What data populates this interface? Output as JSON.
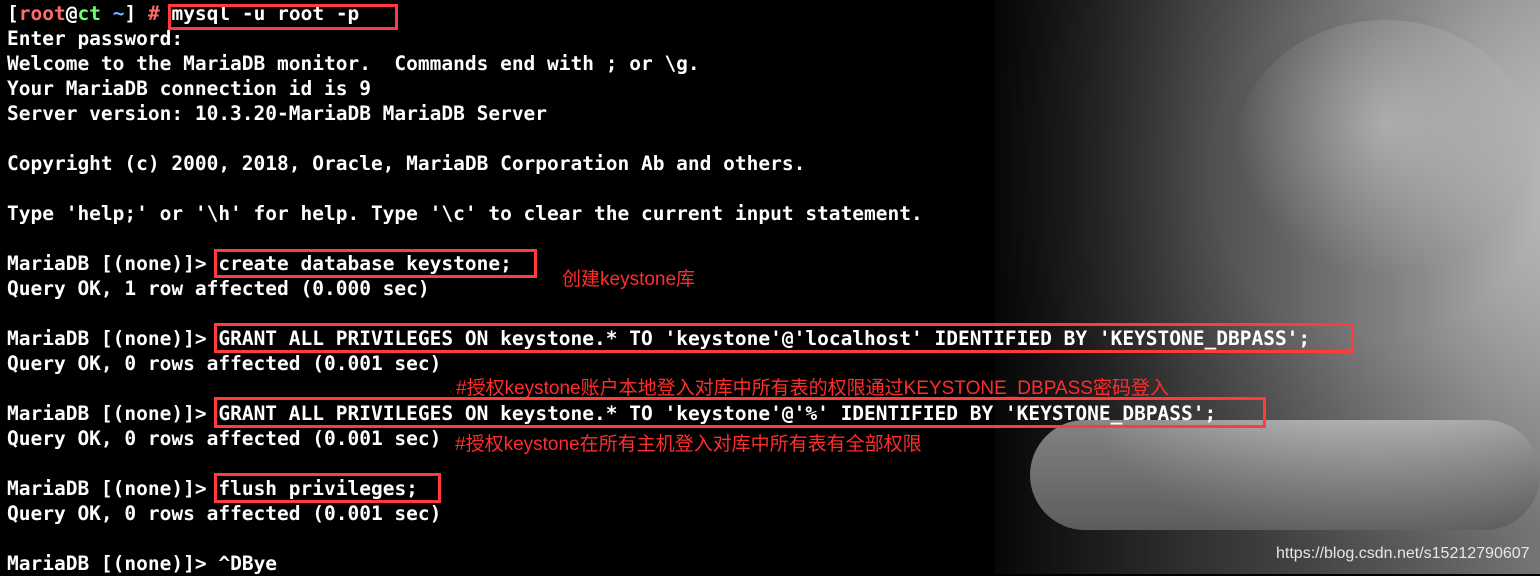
{
  "terminal": {
    "prompt_root": "root",
    "prompt_at": "@",
    "prompt_host": "ct",
    "prompt_path": "~",
    "prompt_hash": "#",
    "login_command": "mysql -u root -p",
    "lines": [
      "Enter password:",
      "Welcome to the MariaDB monitor.  Commands end with ; or \\g.",
      "Your MariaDB connection id is 9",
      "Server version: 10.3.20-MariaDB MariaDB Server",
      "",
      "Copyright (c) 2000, 2018, Oracle, MariaDB Corporation Ab and others.",
      "",
      "Type 'help;' or '\\h' for help. Type '\\c' to clear the current input statement.",
      ""
    ],
    "mariadb_prompt": "MariaDB [(none)]>",
    "commands": [
      {
        "cmd": "create database keystone;",
        "result": "Query OK, 1 row affected (0.000 sec)"
      },
      {
        "cmd": "GRANT ALL PRIVILEGES ON keystone.* TO 'keystone'@'localhost' IDENTIFIED BY 'KEYSTONE_DBPASS';",
        "result": "Query OK, 0 rows affected (0.001 sec)"
      },
      {
        "cmd": "GRANT ALL PRIVILEGES ON keystone.* TO 'keystone'@'%' IDENTIFIED BY 'KEYSTONE_DBPASS';",
        "result": "Query OK, 0 rows affected (0.001 sec)"
      },
      {
        "cmd": "flush privileges;",
        "result": "Query OK, 0 rows affected (0.001 sec)"
      }
    ],
    "last_input": "^DBye"
  },
  "annotations": {
    "create_db": "创建keystone库",
    "grant_local": "#授权keystone账户本地登入对库中所有表的权限通过KEYSTONE_DBPASS密码登入",
    "grant_all": "#授权keystone在所有主机登入对库中所有表有全部权限"
  },
  "watermark": "https://blog.csdn.net/s15212790607",
  "colors": {
    "highlight_box": "#ff3b3b",
    "annotation": "#ff2d2d",
    "terminal_bg": "#000000",
    "terminal_text": "#ffffff"
  }
}
